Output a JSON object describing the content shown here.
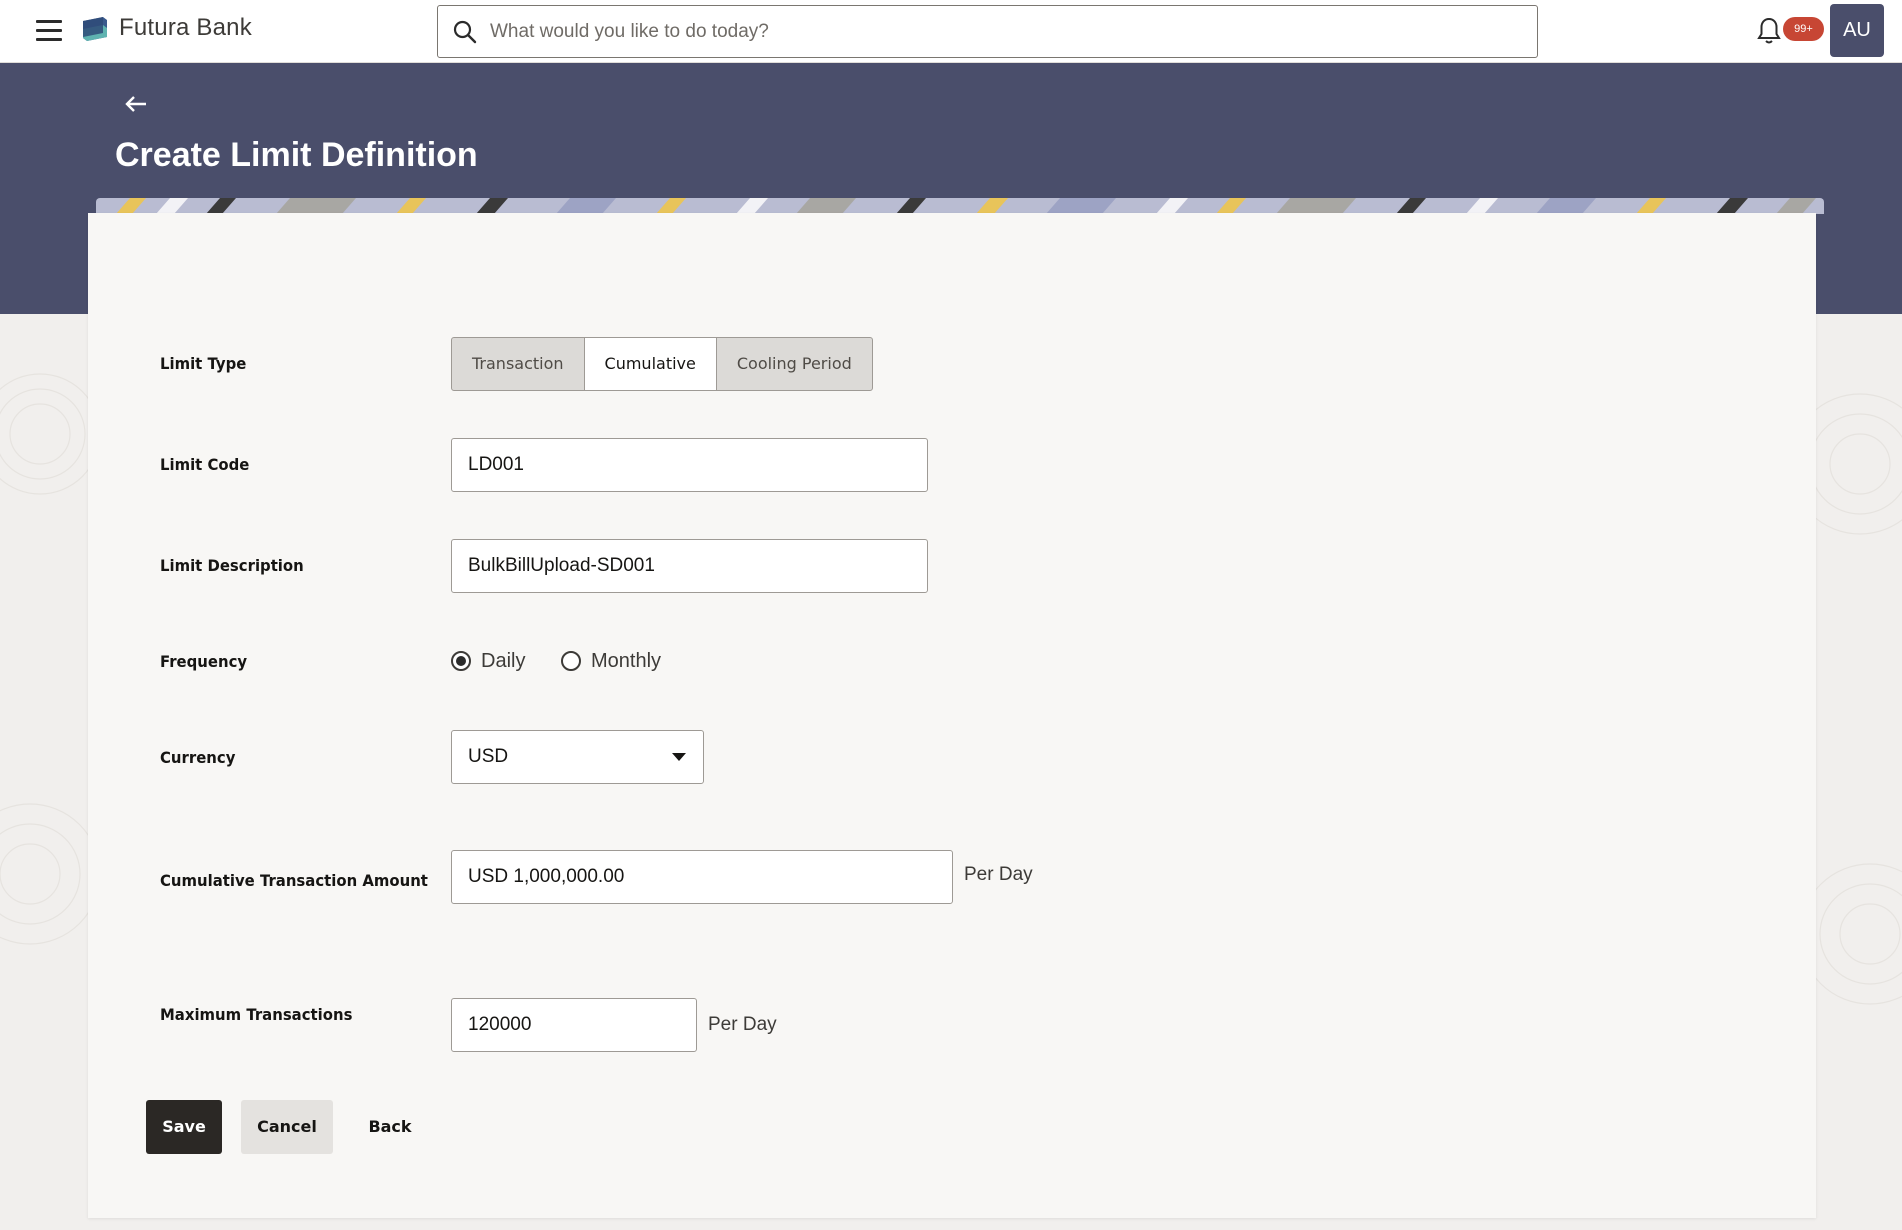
{
  "app": {
    "brand": "Futura Bank",
    "search_placeholder": "What would you like to do today?",
    "notification_count": "99+",
    "avatar_initials": "AU"
  },
  "page": {
    "title": "Create Limit Definition"
  },
  "form": {
    "limit_type": {
      "label": "Limit Type",
      "options": [
        "Transaction",
        "Cumulative",
        "Cooling Period"
      ],
      "selected": "Cumulative"
    },
    "limit_code": {
      "label": "Limit Code",
      "value": "LD001"
    },
    "limit_description": {
      "label": "Limit Description",
      "value": "BulkBillUpload-SD001"
    },
    "frequency": {
      "label": "Frequency",
      "options": [
        "Daily",
        "Monthly"
      ],
      "selected": "Daily"
    },
    "currency": {
      "label": "Currency",
      "value": "USD"
    },
    "cumulative_amount": {
      "label": "Cumulative Transaction Amount",
      "value": "USD 1,000,000.00",
      "suffix": "Per Day"
    },
    "max_transactions": {
      "label": "Maximum Transactions",
      "value": "120000",
      "suffix": "Per Day"
    }
  },
  "actions": {
    "save": "Save",
    "cancel": "Cancel",
    "back": "Back"
  },
  "colors": {
    "header_band": "#4a4e6b",
    "primary_button": "#2b2825",
    "badge": "#c74634"
  }
}
